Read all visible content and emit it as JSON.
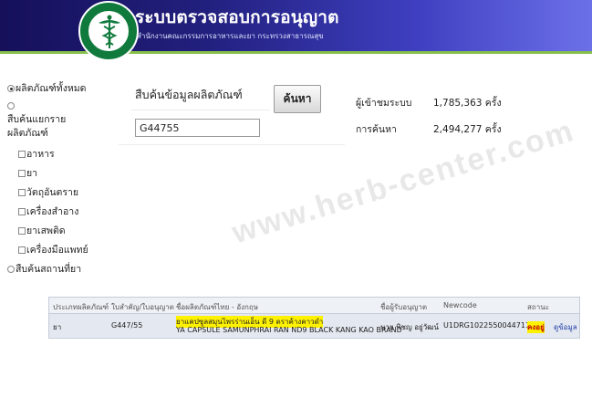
{
  "header": {
    "title": "ระบบตรวจสอบการอนุญาต",
    "subtitle": "สำนักงานคณะกรรมการอาหารและยา กระทรวงสาธารณสุข",
    "logo_icon": "ministry-of-public-health-logo",
    "logo_text": "MINISTRY OF PUBLIC HEALTH",
    "gradient_colors": [
      "#16105a",
      "#6c70e8"
    ],
    "accent_line_color": "#86c04a"
  },
  "sidebar": {
    "all_products": "ผลิตภัณฑ์ทั้งหมด",
    "by_category_line1": "สืบค้นแยกราย",
    "by_category_line2": "ผลิตภัณฑ์",
    "categories": [
      "อาหาร",
      "ยา",
      "วัตถุอันตราย",
      "เครื่องสำอาง",
      "ยาเสพติด",
      "เครื่องมือแพทย์"
    ],
    "search_location": "สืบค้นสถานที่ยา"
  },
  "search": {
    "title": "สืบค้นข้อมูลผลิตภัณฑ์",
    "value": "G44755",
    "button_label": "ค้นหา"
  },
  "stats": {
    "visitors_label": "ผู้เข้าชมระบบ",
    "visitors_value": "1,785,363 ครั้ง",
    "searches_label": "การค้นหา",
    "searches_value": "2,494,277 ครั้ง"
  },
  "watermark": "www.herb-center.com",
  "results": {
    "headers": [
      "ประเภทผลิตภัณฑ์",
      "ใบสำคัญ/ใบอนุญาต",
      "ชื่อผลิตภัณฑ์ไทย - อังกฤษ",
      "ชื่อผู้รับอนุญาต",
      "Newcode",
      "สถานะ",
      ""
    ],
    "rows": [
      {
        "type": "ยา",
        "license": "G447/55",
        "name_th": "ยาแคปซูลสมุนไพรร่านเอ็น ดี 9 ตราค้างคาวดำ",
        "name_en": "YA CAPSULE SAMUNPHRAI RAN ND9 BLACK KANG KAO BRAND",
        "licensee": "นาย พิชญ อยู่วัฒน์",
        "newcode": "U1DRG1022550044711C",
        "status": "คงอยู่",
        "detail_link": "ดูข้อมูล"
      }
    ]
  }
}
